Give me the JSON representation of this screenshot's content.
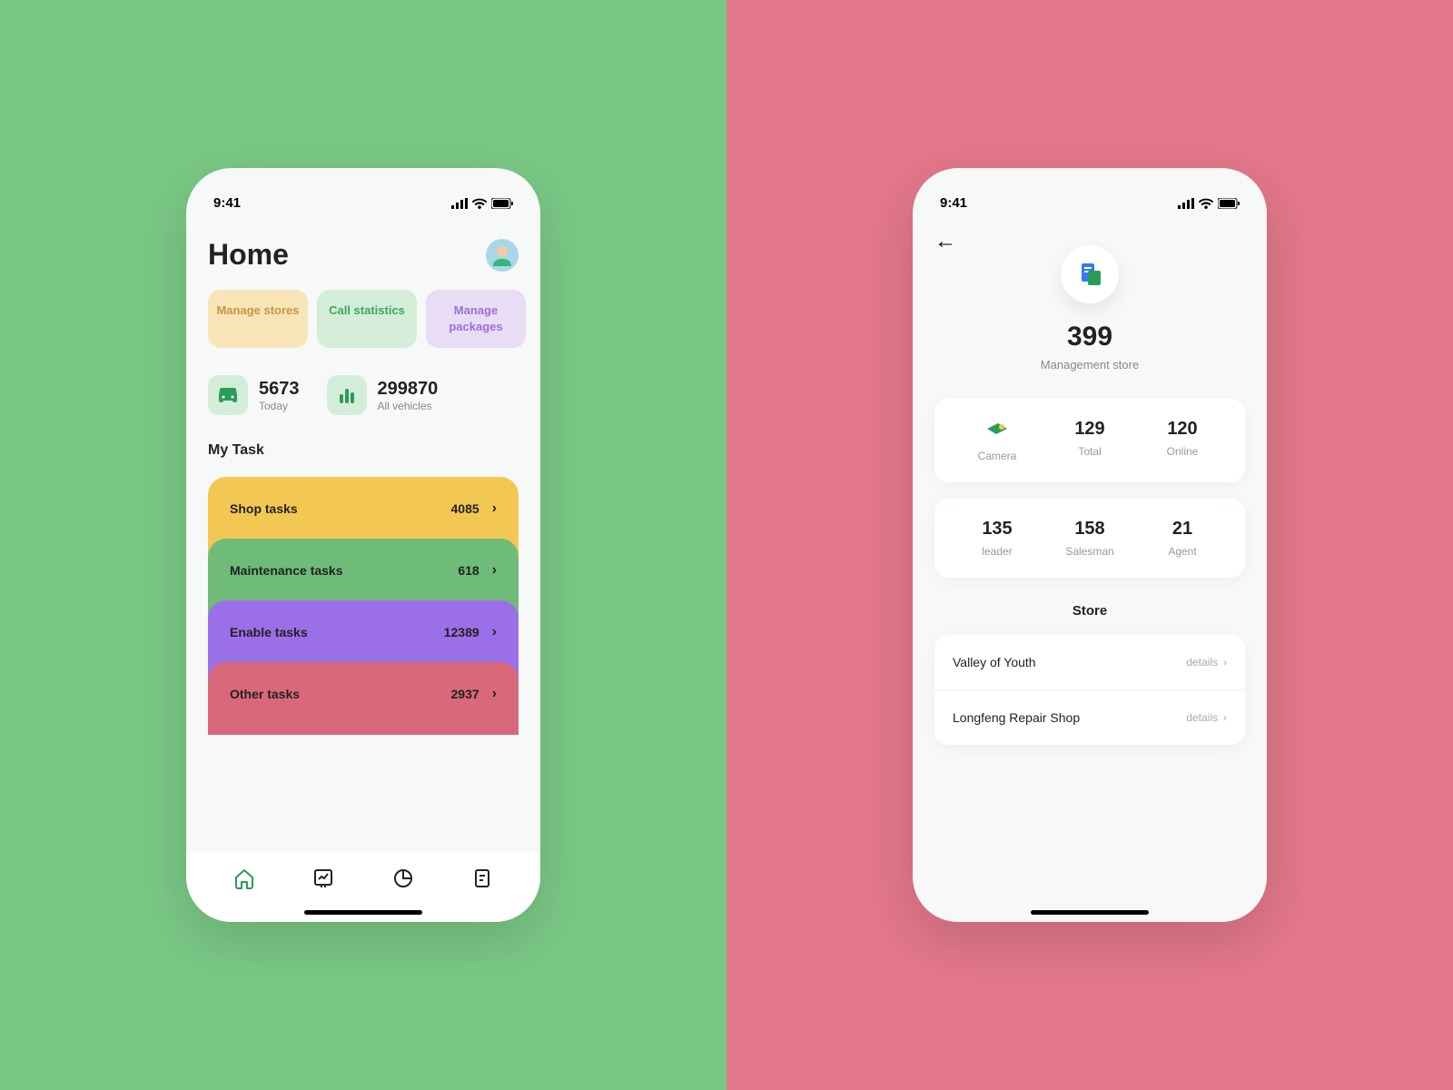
{
  "status_time": "9:41",
  "left": {
    "title": "Home",
    "chips": [
      {
        "label": "Manage stores"
      },
      {
        "label": "Call statistics"
      },
      {
        "label": "Manage packages"
      }
    ],
    "stats": [
      {
        "value": "5673",
        "label": "Today"
      },
      {
        "value": "299870",
        "label": "All vehicles"
      }
    ],
    "tasks_title": "My Task",
    "tasks": [
      {
        "name": "Shop tasks",
        "count": "4085"
      },
      {
        "name": "Maintenance tasks",
        "count": "618"
      },
      {
        "name": "Enable tasks",
        "count": "12389"
      },
      {
        "name": "Other tasks",
        "count": "2937"
      }
    ]
  },
  "right": {
    "count": "399",
    "count_label": "Management store",
    "card1": [
      {
        "label": "Camera"
      },
      {
        "value": "129",
        "label": "Total"
      },
      {
        "value": "120",
        "label": "Online"
      }
    ],
    "card2": [
      {
        "value": "135",
        "label": "leader"
      },
      {
        "value": "158",
        "label": "Salesman"
      },
      {
        "value": "21",
        "label": "Agent"
      }
    ],
    "store_title": "Store",
    "stores": [
      {
        "name": "Valley of Youth",
        "action": "details"
      },
      {
        "name": "Longfeng Repair Shop",
        "action": "details"
      }
    ]
  }
}
